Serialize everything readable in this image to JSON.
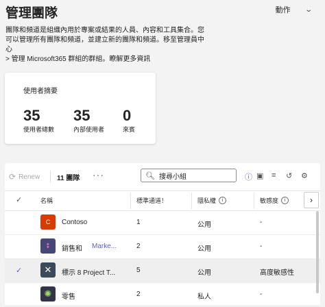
{
  "header": {
    "title": "管理團隊",
    "actions_label": "動作"
  },
  "description": {
    "line1": "團隊和頻道是組織內用於專案或結果的人員、內容和工具集合。您",
    "line2": "可以管理所有團隊和頻道，並建立新的團隊和頻道。移至管理員中心",
    "line3": "> 管理 Microsoft365 群組的群組。瞭解更多資訊"
  },
  "summary": {
    "title": "使用者摘要",
    "stats": [
      {
        "value": "35",
        "label": "使用者總數"
      },
      {
        "value": "35",
        "label": "內部使用者"
      },
      {
        "value": "0",
        "label": "來賓"
      }
    ]
  },
  "toolbar": {
    "renew_label": "Renew",
    "team_count": "11 團隊",
    "more": "···",
    "search_placeholder": "搜尋小組"
  },
  "table": {
    "columns": {
      "name": "名稱",
      "standard_channels": "標準通道！",
      "privacy": "隱私權",
      "sensitivity": "敏感度"
    },
    "rows": [
      {
        "name": "Contoso",
        "sub": "",
        "avatar_text": "C",
        "avatar_color": "#d83b01",
        "channels": "1",
        "privacy": "公用",
        "sensitivity": "-",
        "selected": false
      },
      {
        "name": "銷售和",
        "sub": "Marke...",
        "avatar_text": "",
        "avatar_color": "#464775",
        "channels": "2",
        "privacy": "公用",
        "sensitivity": "-",
        "selected": false
      },
      {
        "name": "標示 8 Project T...",
        "sub": "",
        "avatar_text": "",
        "avatar_color": "#3b4a5a",
        "channels": "5",
        "privacy": "公用",
        "sensitivity": "高度敏感性",
        "selected": true
      },
      {
        "name": "零售",
        "sub": "",
        "avatar_text": "",
        "avatar_color": "#33344a",
        "channels": "2",
        "privacy": "私人",
        "sensitivity": "-",
        "selected": false
      }
    ]
  }
}
